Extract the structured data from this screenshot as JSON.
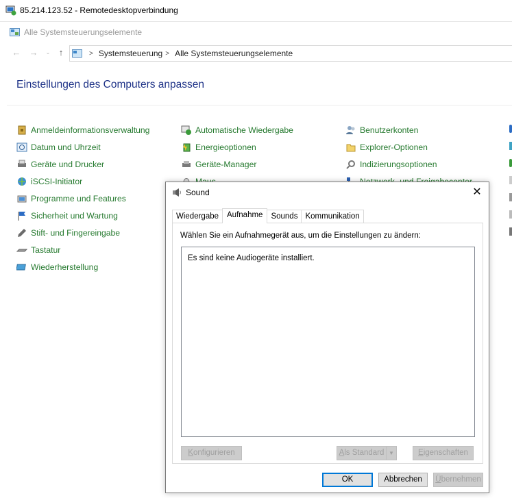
{
  "rdp": {
    "title": "85.214.123.52 - Remotedesktopverbindung"
  },
  "window": {
    "title": "Alle Systemsteuerungselemente"
  },
  "address": {
    "crumbs": [
      "Systemsteuerung",
      "Alle Systemsteuerungselemente"
    ]
  },
  "page": {
    "heading": "Einstellungen des Computers anpassen"
  },
  "items": {
    "col1": [
      "Anmeldeinformationsverwaltung",
      "Datum und Uhrzeit",
      "Geräte und Drucker",
      "iSCSI-Initiator",
      "Programme und Features",
      "Sicherheit und Wartung",
      "Stift- und Fingereingabe",
      "Tastatur",
      "Wiederherstellung"
    ],
    "col2": [
      "Automatische Wiedergabe",
      "Energieoptionen",
      "Geräte-Manager",
      "Maus"
    ],
    "col3": [
      "Benutzerkonten",
      "Explorer-Optionen",
      "Indizierungsoptionen",
      "Netzwerk- und Freigabecenter"
    ]
  },
  "dialog": {
    "title": "Sound",
    "tabs": [
      "Wiedergabe",
      "Aufnahme",
      "Sounds",
      "Kommunikation"
    ],
    "active_tab": "Aufnahme",
    "instruction": "Wählen Sie ein Aufnahmegerät aus, um die Einstellungen zu ändern:",
    "empty_message": "Es sind keine Audiogeräte installiert.",
    "buttons": {
      "configure_mnemonic": "K",
      "configure_rest": "onfigurieren",
      "default_mnemonic": "A",
      "default_rest": "ls Standard",
      "properties_mnemonic": "E",
      "properties_rest": "igenschaften",
      "ok": "OK",
      "cancel": "Abbrechen",
      "apply_mnemonic": "Ü",
      "apply_rest": "bernehmen"
    }
  },
  "colors": {
    "link": "#267a2f",
    "heading": "#1e3287",
    "default_button_border": "#0078d7"
  }
}
